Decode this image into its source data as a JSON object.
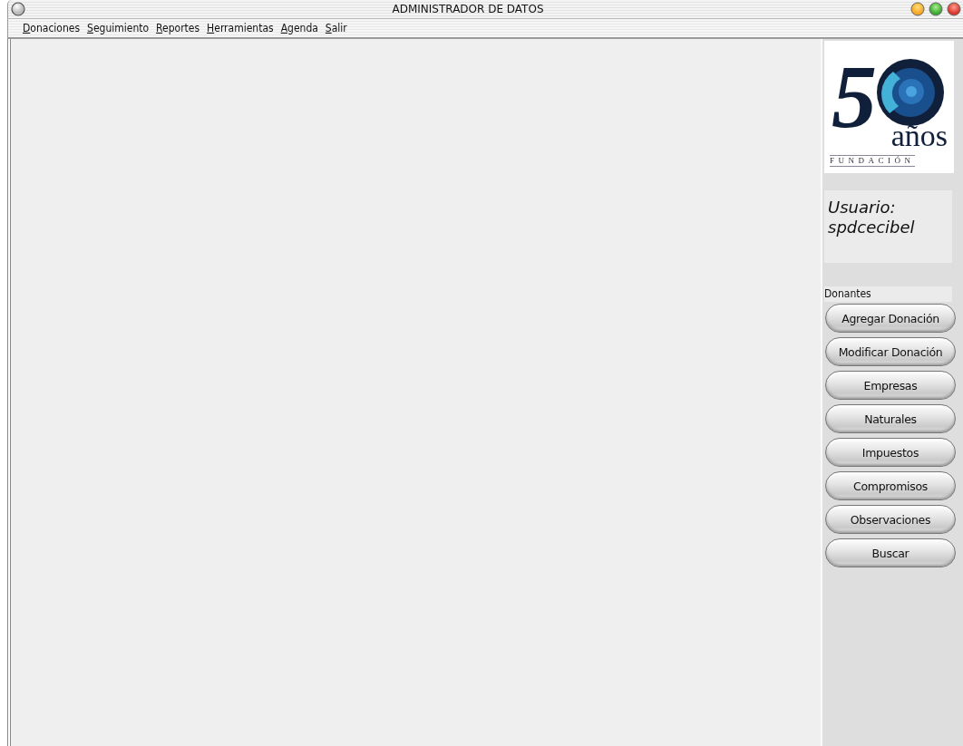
{
  "window": {
    "title": "ADMINISTRADOR DE DATOS"
  },
  "menu": [
    "Donaciones",
    "Seguimiento",
    "Reportes",
    "Herramientas",
    "Agenda",
    "Salir"
  ],
  "logo": {
    "number": "5",
    "word": "años",
    "subtitle": "FUNDACIÓN"
  },
  "user": {
    "label": "Usuario:",
    "name": "spdcecibel"
  },
  "section": "Donantes",
  "buttons": [
    "Agregar Donación",
    "Modificar Donación",
    "Empresas",
    "Naturales",
    "Impuestos",
    "Compromisos",
    "Observaciones",
    "Buscar"
  ]
}
